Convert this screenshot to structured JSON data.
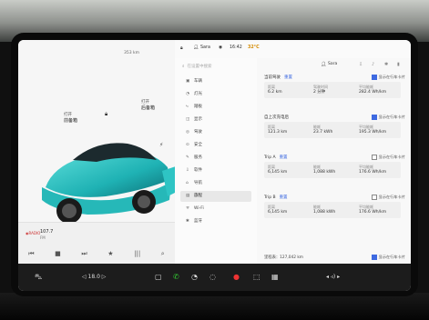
{
  "status": {
    "range": "353 km",
    "user": "Sara",
    "time": "16:42",
    "temp": "32°C"
  },
  "car": {
    "left_label_top": "打开",
    "left_label_big": "前备箱",
    "right_label_top": "打开",
    "right_label_big": "后备箱"
  },
  "media": {
    "source": "◉RADIO",
    "track": "107.7",
    "subtitle": "FM",
    "controls": [
      "⏮",
      "■",
      "⏭",
      "★",
      "|||",
      "⌕"
    ]
  },
  "search_placeholder": "在设置中搜索",
  "nav": [
    {
      "icon": "▣",
      "label": "车辆"
    },
    {
      "icon": "◔",
      "label": "灯光"
    },
    {
      "icon": "⤷",
      "label": "踏板"
    },
    {
      "icon": "◫",
      "label": "显示"
    },
    {
      "icon": "◎",
      "label": "驾驶"
    },
    {
      "icon": "⊙",
      "label": "安全"
    },
    {
      "icon": "✎",
      "label": "服务"
    },
    {
      "icon": "⇩",
      "label": "软件"
    },
    {
      "icon": "⌂",
      "label": "导航"
    },
    {
      "icon": "▤",
      "label": "旅程",
      "active": true
    },
    {
      "icon": "ᯤ",
      "label": "Wi-Fi"
    },
    {
      "icon": "✱",
      "label": "蓝牙"
    }
  ],
  "content_user": "Sara",
  "cards": [
    {
      "title": "当前驾驶",
      "reset": "重置",
      "checkbox": "显示在行车卡片",
      "checked": true,
      "stats": [
        {
          "k": "距离",
          "v": "6.2 km"
        },
        {
          "k": "驾驶时间",
          "v": "2 分钟"
        },
        {
          "k": "平均能耗",
          "v": "282.4 Wh/km"
        }
      ]
    },
    {
      "title": "自上次充电后",
      "reset": "",
      "checkbox": "显示在行车卡片",
      "checked": true,
      "stats": [
        {
          "k": "距离",
          "v": "121.3 km"
        },
        {
          "k": "能耗",
          "v": "23.7 kWh"
        },
        {
          "k": "平均能耗",
          "v": "195.3 Wh/km"
        }
      ]
    },
    {
      "title": "Trip A",
      "reset": "重置",
      "checkbox": "显示在行车卡片",
      "checked": false,
      "stats": [
        {
          "k": "距离",
          "v": "6,145 km"
        },
        {
          "k": "能耗",
          "v": "1,088 kWh"
        },
        {
          "k": "平均能耗",
          "v": "176.6 Wh/km"
        }
      ]
    },
    {
      "title": "Trip B",
      "reset": "重置",
      "checkbox": "显示在行车卡片",
      "checked": false,
      "stats": [
        {
          "k": "距离",
          "v": "6,145 km"
        },
        {
          "k": "能耗",
          "v": "1,088 kWh"
        },
        {
          "k": "平均能耗",
          "v": "176.6 Wh/km"
        }
      ]
    }
  ],
  "odometer": "里程表：127,042 km",
  "odometer_check": "显示在行车卡片",
  "dock": [
    "⛍",
    "◁ 18.0 ▷",
    "▢",
    "✆",
    "◔",
    "◌",
    "●",
    "⬚",
    "▦",
    "◂ ◃) ▸"
  ]
}
